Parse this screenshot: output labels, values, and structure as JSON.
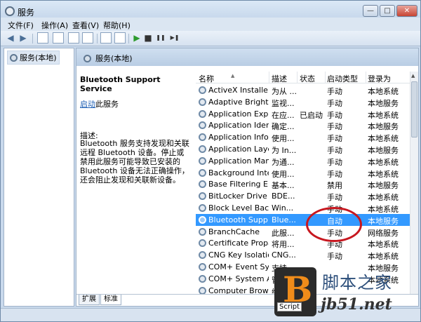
{
  "window": {
    "title": "服务"
  },
  "titlebar": {
    "minimize": "—",
    "maximize": "□",
    "close": "✕"
  },
  "menu": [
    "文件(F)",
    "操作(A)",
    "查看(V)",
    "帮助(H)"
  ],
  "toolbar": {
    "back": "◀",
    "forward": "▶",
    "play": "▶",
    "stop": "■",
    "pause": "❚❚",
    "restart": "▶❚"
  },
  "tree": {
    "root": "服务(本地)"
  },
  "header": {
    "title": "服务(本地)"
  },
  "detail": {
    "service_name": "Bluetooth Support Service",
    "start_link": "启动",
    "start_suffix": "此服务",
    "desc_label": "描述:",
    "description": "Bluetooth 服务支持发现和关联远程 Bluetooth 设备。停止或禁用此服务可能导致已安装的 Bluetooth 设备无法正确操作，还会阻止发现和关联新设备。"
  },
  "columns": {
    "name": "名称",
    "desc": "描述",
    "status": "状态",
    "startup": "启动类型",
    "logon": "登录为"
  },
  "rows": [
    {
      "name": "ActiveX Installer ...",
      "desc": "为从 ...",
      "status": "",
      "startup": "手动",
      "logon": "本地系统"
    },
    {
      "name": "Adaptive Brightn...",
      "desc": "监视...",
      "status": "",
      "startup": "手动",
      "logon": "本地服务"
    },
    {
      "name": "Application Expe...",
      "desc": "在应...",
      "status": "已启动",
      "startup": "手动",
      "logon": "本地系统"
    },
    {
      "name": "Application Iden...",
      "desc": "确定...",
      "status": "",
      "startup": "手动",
      "logon": "本地服务"
    },
    {
      "name": "Application Infor...",
      "desc": "使用...",
      "status": "",
      "startup": "手动",
      "logon": "本地系统"
    },
    {
      "name": "Application Laye...",
      "desc": "为 In...",
      "status": "",
      "startup": "手动",
      "logon": "本地服务"
    },
    {
      "name": "Application Man...",
      "desc": "为通...",
      "status": "",
      "startup": "手动",
      "logon": "本地系统"
    },
    {
      "name": "Background Inte...",
      "desc": "使用...",
      "status": "",
      "startup": "手动",
      "logon": "本地系统"
    },
    {
      "name": "Base Filtering En...",
      "desc": "基本...",
      "status": "",
      "startup": "禁用",
      "logon": "本地服务"
    },
    {
      "name": "BitLocker Drive ...",
      "desc": "BDE...",
      "status": "",
      "startup": "手动",
      "logon": "本地系统"
    },
    {
      "name": "Block Level Back...",
      "desc": "Win...",
      "status": "",
      "startup": "手动",
      "logon": "本地系统"
    },
    {
      "name": "Bluetooth Supp...",
      "desc": "Blue...",
      "status": "",
      "startup": "自动",
      "logon": "本地服务",
      "selected": true
    },
    {
      "name": "BranchCache",
      "desc": "此服...",
      "status": "",
      "startup": "手动",
      "logon": "网络服务"
    },
    {
      "name": "Certificate Propa...",
      "desc": "将用...",
      "status": "",
      "startup": "手动",
      "logon": "本地系统"
    },
    {
      "name": "CNG Key Isolation",
      "desc": "CNG...",
      "status": "",
      "startup": "手动",
      "logon": "本地系统"
    },
    {
      "name": "COM+ Event Sys...",
      "desc": "支持...",
      "status": "",
      "startup": "",
      "logon": "本地服务"
    },
    {
      "name": "COM+ System A...",
      "desc": "管理...",
      "status": "",
      "startup": "",
      "logon": "本地系统"
    },
    {
      "name": "Computer Brow...",
      "desc": "维护...",
      "status": "",
      "startup": "",
      "logon": ""
    }
  ],
  "tabs": [
    "扩展",
    "标准"
  ],
  "watermark": {
    "logo_letter": "B",
    "script_label": "Script",
    "site_cn": "脚本之家",
    "site_en": "jb51.net"
  },
  "colors": {
    "selection": "#3399ff",
    "highlight_oval": "#c7171f"
  }
}
